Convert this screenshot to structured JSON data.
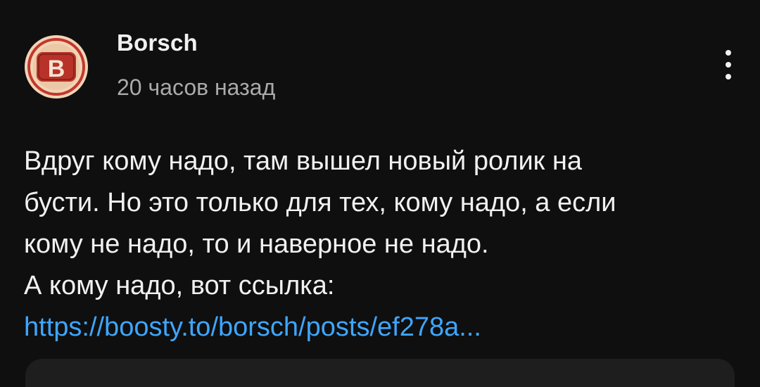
{
  "post": {
    "author": {
      "name": "Borsch",
      "avatar_icon": "borsch-logo-icon",
      "avatar_letter": "B"
    },
    "timestamp": "20 часов назад",
    "menu_icon": "more-vertical-icon",
    "body_lines": [
      "Вдруг кому надо, там вышел новый ролик на",
      "бусти. Но это только для тех, кому надо, а если",
      "кому не надо, то и наверное не надо.",
      "А кому надо, вот ссылка:"
    ],
    "link_text": "https://boosty.to/borsch/posts/ef278a..."
  },
  "colors": {
    "background": "#0f0f0f",
    "primary_text": "#f1f1f1",
    "secondary_text": "#aaaaaa",
    "link": "#3ea6ff",
    "avatar_outer": "#f2d4b6",
    "avatar_ring": "#c2382e",
    "avatar_badge": "#b8322a"
  }
}
